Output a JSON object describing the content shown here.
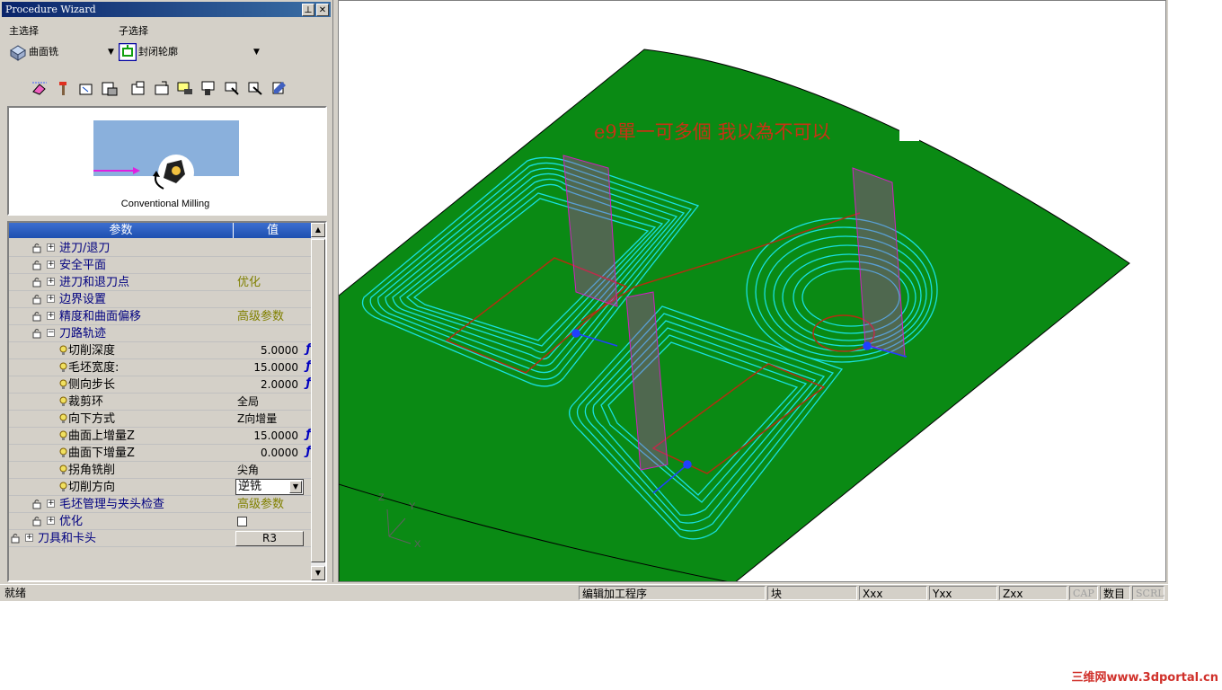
{
  "wizard": {
    "title": "Procedure Wizard",
    "pin_glyph": "⊥",
    "close_glyph": "✕",
    "main_select_label": "主选择",
    "sub_select_label": "子选择",
    "main_select_value": "曲面铣",
    "sub_select_value": "封闭轮廓",
    "toolbar_icons": [
      "eraser-icon",
      "tool-icon",
      "sequence-icon",
      "stock-icon",
      "save-icon",
      "open-icon",
      "simulate-icon",
      "gouge-check-icon",
      "verify-icon",
      "post-icon",
      "settings-icon"
    ]
  },
  "preview": {
    "caption": "Conventional Milling"
  },
  "grid": {
    "col_param": "参数",
    "col_value": "值",
    "rows": [
      {
        "name": "进刀/退刀",
        "value": ""
      },
      {
        "name": "安全平面",
        "value": ""
      },
      {
        "name": "进刀和退刀点",
        "value": "优化"
      },
      {
        "name": "边界设置",
        "value": ""
      },
      {
        "name": "精度和曲面偏移",
        "value": "高级参数"
      },
      {
        "name": "刀路轨迹",
        "value": ""
      },
      {
        "name": "切削深度",
        "value": "5.0000"
      },
      {
        "name": "毛坯宽度:",
        "value": "15.0000"
      },
      {
        "name": "侧向步长",
        "value": "2.0000"
      },
      {
        "name": "裁剪环",
        "value": "全局"
      },
      {
        "name": "向下方式",
        "value": "Z向增量"
      },
      {
        "name": "曲面上增量Z",
        "value": "15.0000"
      },
      {
        "name": "曲面下增量Z",
        "value": "0.0000"
      },
      {
        "name": "拐角铣削",
        "value": "尖角"
      },
      {
        "name": "切削方向",
        "value": "逆铣"
      },
      {
        "name": "毛坯管理与夹头检查",
        "value": "高级参数"
      },
      {
        "name": "优化",
        "value": ""
      },
      {
        "name": "刀具和卡头",
        "value": "R3"
      }
    ],
    "fx_symbol": "ƒ"
  },
  "viewport": {
    "annotation": "e9單一可多個 我以為不可以",
    "axis_x": "X",
    "axis_y": "Y",
    "axis_z": "Z",
    "surface_color": "#0a8a14",
    "toolpath_color": "#19e0e0",
    "entry_color": "#d020c0",
    "boundary_color": "#b03010"
  },
  "status": {
    "ready": "就绪",
    "mode": "编辑加工程序",
    "block": "块",
    "x": "Xxx",
    "y": "Yxx",
    "z": "Zxx",
    "cap": "CAP",
    "num": "数目",
    "scrl": "SCRL"
  },
  "watermark": "三维网www.3dportal.cn"
}
